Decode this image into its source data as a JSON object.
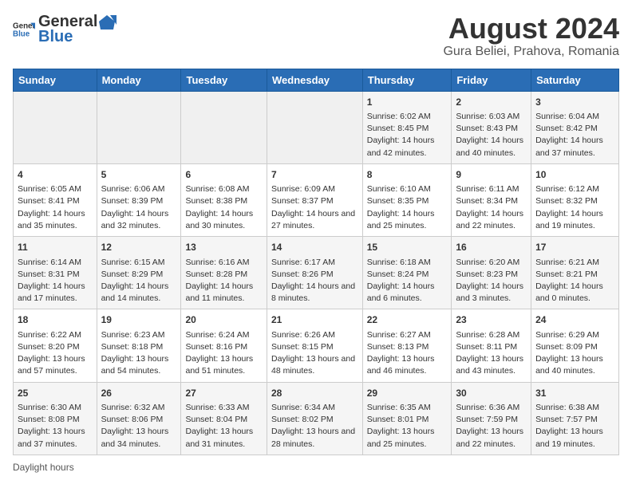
{
  "header": {
    "logo_general": "General",
    "logo_blue": "Blue",
    "month_year": "August 2024",
    "location": "Gura Beliei, Prahova, Romania"
  },
  "days_of_week": [
    "Sunday",
    "Monday",
    "Tuesday",
    "Wednesday",
    "Thursday",
    "Friday",
    "Saturday"
  ],
  "weeks": [
    [
      {
        "day": "",
        "content": ""
      },
      {
        "day": "",
        "content": ""
      },
      {
        "day": "",
        "content": ""
      },
      {
        "day": "",
        "content": ""
      },
      {
        "day": "1",
        "content": "Sunrise: 6:02 AM\nSunset: 8:45 PM\nDaylight: 14 hours and 42 minutes."
      },
      {
        "day": "2",
        "content": "Sunrise: 6:03 AM\nSunset: 8:43 PM\nDaylight: 14 hours and 40 minutes."
      },
      {
        "day": "3",
        "content": "Sunrise: 6:04 AM\nSunset: 8:42 PM\nDaylight: 14 hours and 37 minutes."
      }
    ],
    [
      {
        "day": "4",
        "content": "Sunrise: 6:05 AM\nSunset: 8:41 PM\nDaylight: 14 hours and 35 minutes."
      },
      {
        "day": "5",
        "content": "Sunrise: 6:06 AM\nSunset: 8:39 PM\nDaylight: 14 hours and 32 minutes."
      },
      {
        "day": "6",
        "content": "Sunrise: 6:08 AM\nSunset: 8:38 PM\nDaylight: 14 hours and 30 minutes."
      },
      {
        "day": "7",
        "content": "Sunrise: 6:09 AM\nSunset: 8:37 PM\nDaylight: 14 hours and 27 minutes."
      },
      {
        "day": "8",
        "content": "Sunrise: 6:10 AM\nSunset: 8:35 PM\nDaylight: 14 hours and 25 minutes."
      },
      {
        "day": "9",
        "content": "Sunrise: 6:11 AM\nSunset: 8:34 PM\nDaylight: 14 hours and 22 minutes."
      },
      {
        "day": "10",
        "content": "Sunrise: 6:12 AM\nSunset: 8:32 PM\nDaylight: 14 hours and 19 minutes."
      }
    ],
    [
      {
        "day": "11",
        "content": "Sunrise: 6:14 AM\nSunset: 8:31 PM\nDaylight: 14 hours and 17 minutes."
      },
      {
        "day": "12",
        "content": "Sunrise: 6:15 AM\nSunset: 8:29 PM\nDaylight: 14 hours and 14 minutes."
      },
      {
        "day": "13",
        "content": "Sunrise: 6:16 AM\nSunset: 8:28 PM\nDaylight: 14 hours and 11 minutes."
      },
      {
        "day": "14",
        "content": "Sunrise: 6:17 AM\nSunset: 8:26 PM\nDaylight: 14 hours and 8 minutes."
      },
      {
        "day": "15",
        "content": "Sunrise: 6:18 AM\nSunset: 8:24 PM\nDaylight: 14 hours and 6 minutes."
      },
      {
        "day": "16",
        "content": "Sunrise: 6:20 AM\nSunset: 8:23 PM\nDaylight: 14 hours and 3 minutes."
      },
      {
        "day": "17",
        "content": "Sunrise: 6:21 AM\nSunset: 8:21 PM\nDaylight: 14 hours and 0 minutes."
      }
    ],
    [
      {
        "day": "18",
        "content": "Sunrise: 6:22 AM\nSunset: 8:20 PM\nDaylight: 13 hours and 57 minutes."
      },
      {
        "day": "19",
        "content": "Sunrise: 6:23 AM\nSunset: 8:18 PM\nDaylight: 13 hours and 54 minutes."
      },
      {
        "day": "20",
        "content": "Sunrise: 6:24 AM\nSunset: 8:16 PM\nDaylight: 13 hours and 51 minutes."
      },
      {
        "day": "21",
        "content": "Sunrise: 6:26 AM\nSunset: 8:15 PM\nDaylight: 13 hours and 48 minutes."
      },
      {
        "day": "22",
        "content": "Sunrise: 6:27 AM\nSunset: 8:13 PM\nDaylight: 13 hours and 46 minutes."
      },
      {
        "day": "23",
        "content": "Sunrise: 6:28 AM\nSunset: 8:11 PM\nDaylight: 13 hours and 43 minutes."
      },
      {
        "day": "24",
        "content": "Sunrise: 6:29 AM\nSunset: 8:09 PM\nDaylight: 13 hours and 40 minutes."
      }
    ],
    [
      {
        "day": "25",
        "content": "Sunrise: 6:30 AM\nSunset: 8:08 PM\nDaylight: 13 hours and 37 minutes."
      },
      {
        "day": "26",
        "content": "Sunrise: 6:32 AM\nSunset: 8:06 PM\nDaylight: 13 hours and 34 minutes."
      },
      {
        "day": "27",
        "content": "Sunrise: 6:33 AM\nSunset: 8:04 PM\nDaylight: 13 hours and 31 minutes."
      },
      {
        "day": "28",
        "content": "Sunrise: 6:34 AM\nSunset: 8:02 PM\nDaylight: 13 hours and 28 minutes."
      },
      {
        "day": "29",
        "content": "Sunrise: 6:35 AM\nSunset: 8:01 PM\nDaylight: 13 hours and 25 minutes."
      },
      {
        "day": "30",
        "content": "Sunrise: 6:36 AM\nSunset: 7:59 PM\nDaylight: 13 hours and 22 minutes."
      },
      {
        "day": "31",
        "content": "Sunrise: 6:38 AM\nSunset: 7:57 PM\nDaylight: 13 hours and 19 minutes."
      }
    ]
  ],
  "footer": {
    "daylight_label": "Daylight hours"
  }
}
